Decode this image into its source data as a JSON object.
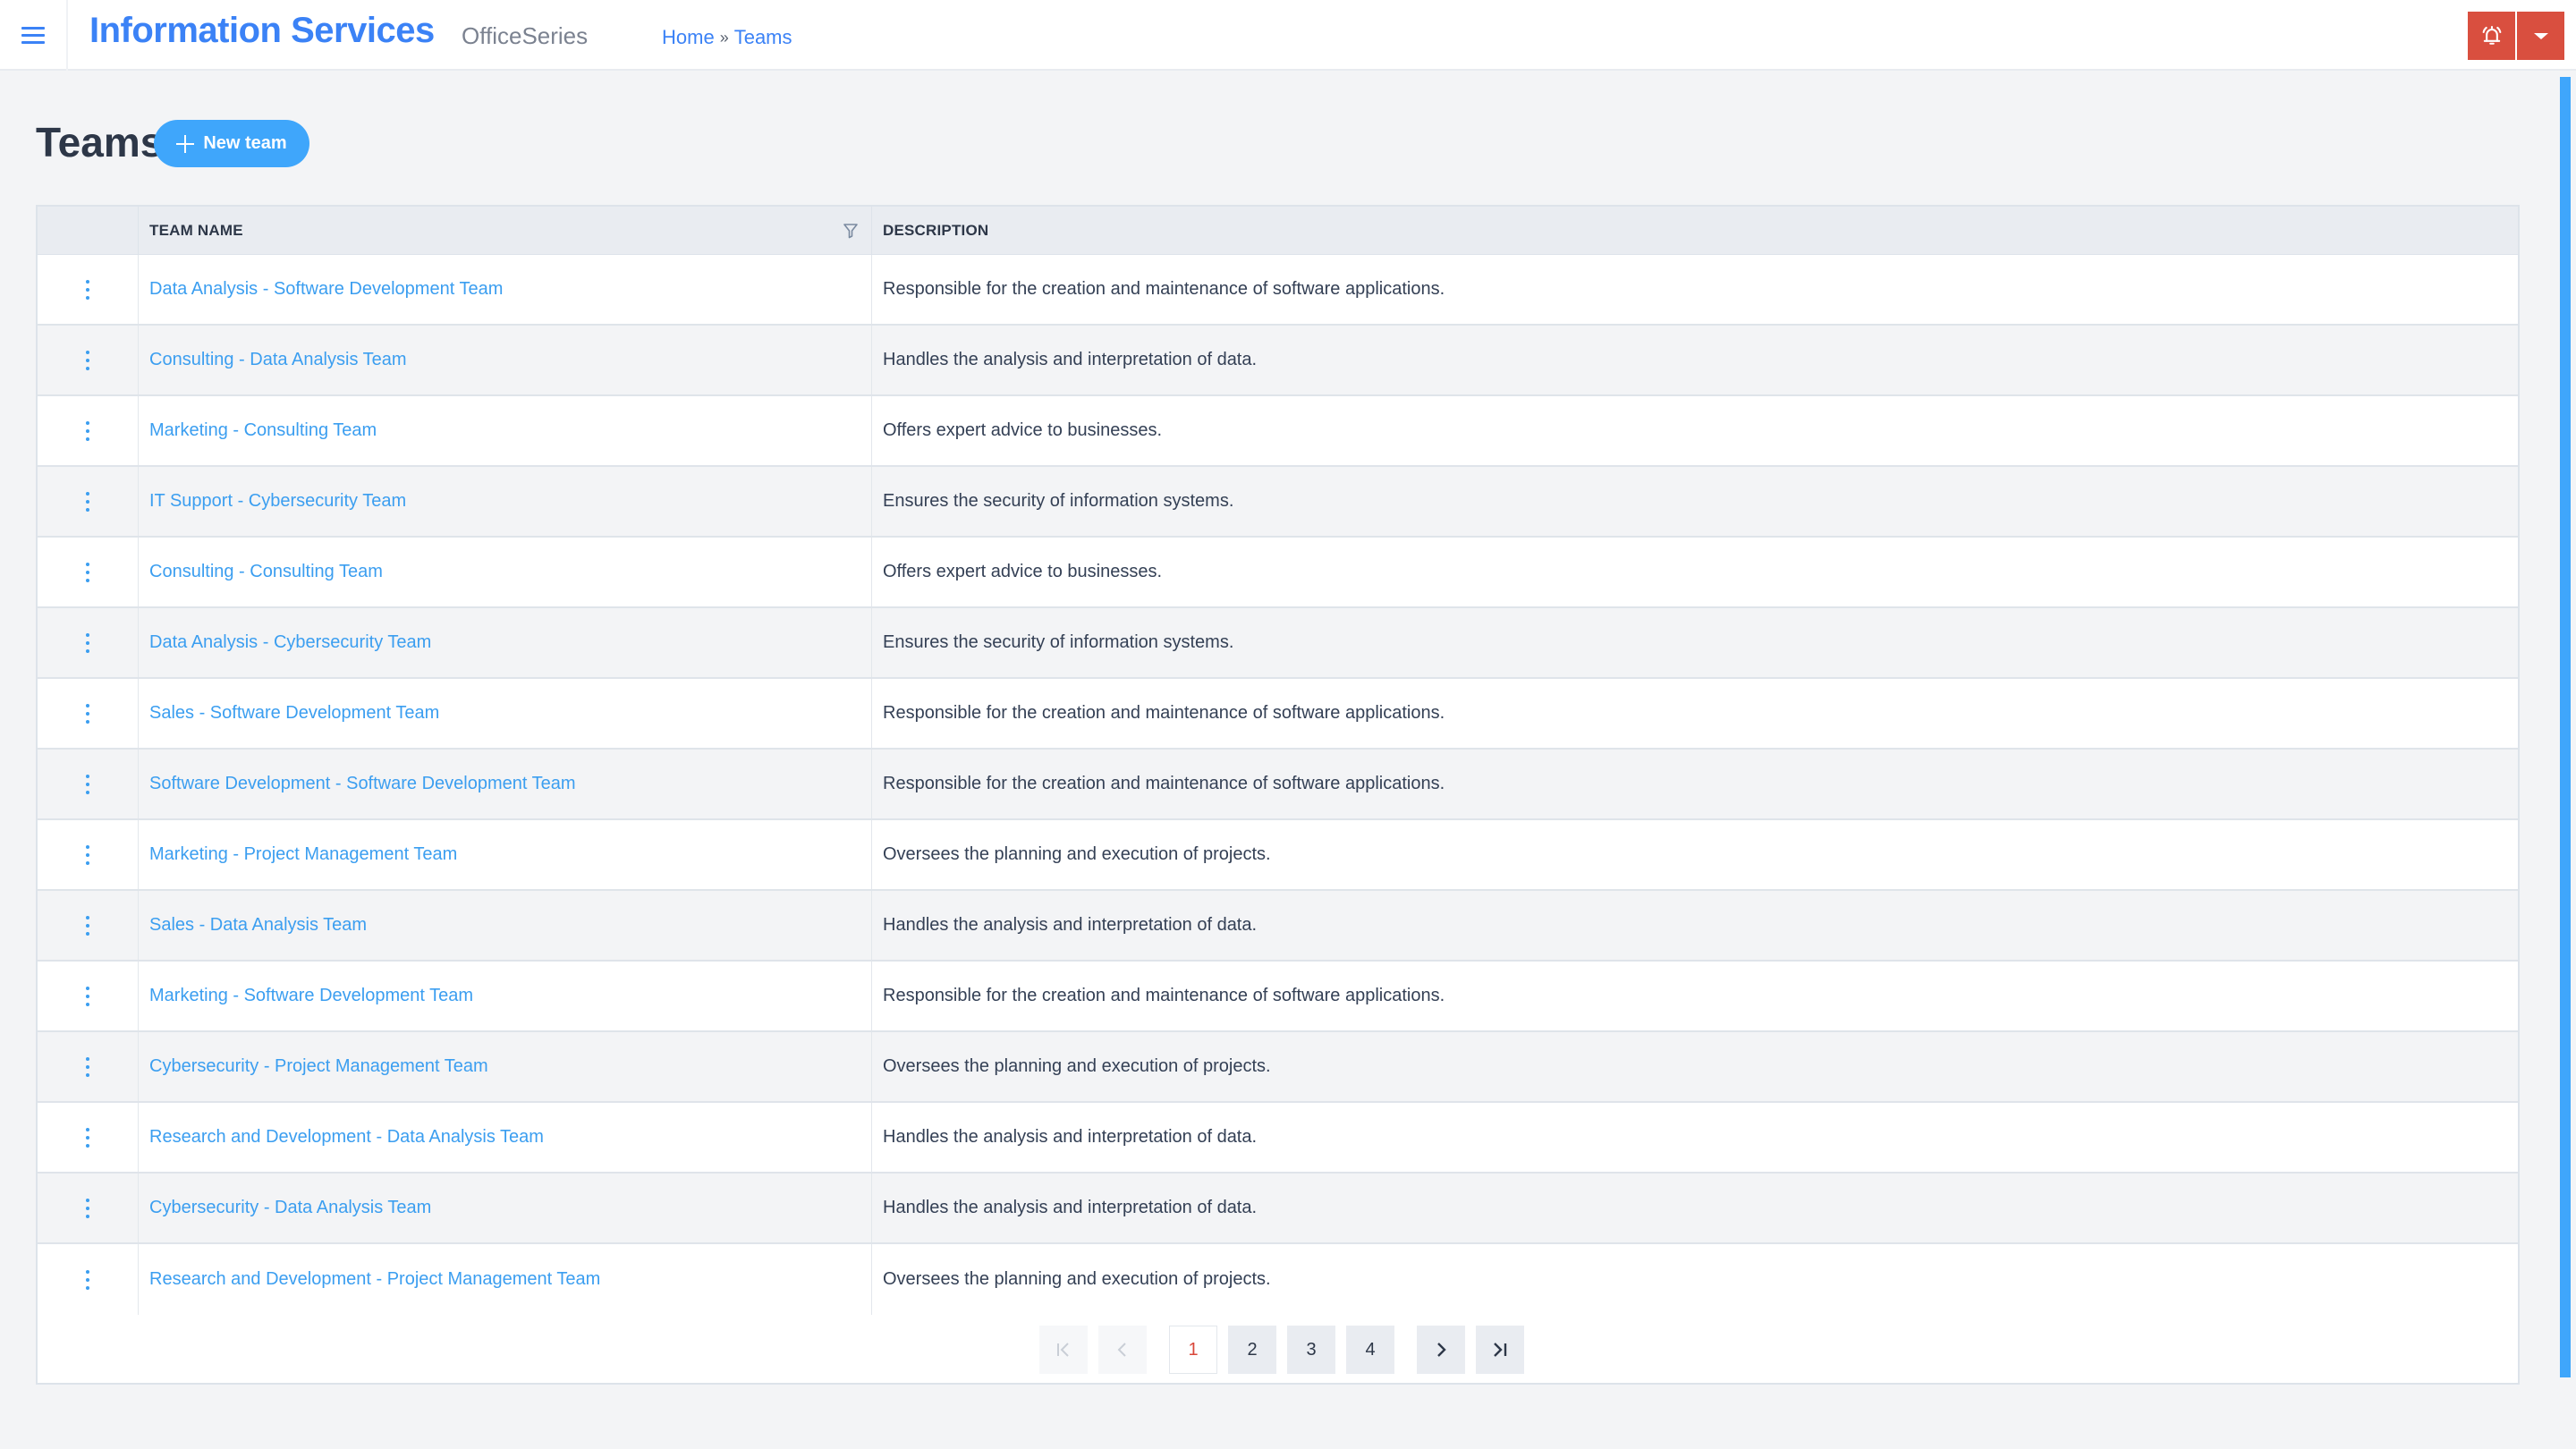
{
  "header": {
    "menu_icon": "hamburger-menu-icon",
    "title": "Information Services",
    "subtitle": "OfficeSeries",
    "breadcrumb": [
      {
        "label": "Home"
      },
      {
        "label": "Teams"
      }
    ],
    "breadcrumb_separator": "»",
    "notification_icon": "bell-ringing-icon",
    "dropdown_icon": "caret-down-icon",
    "accent_color": "#3b82f6",
    "alert_color": "#d94f3f"
  },
  "page": {
    "title": "Teams",
    "new_button_label": "New team",
    "new_button_icon": "plus-icon"
  },
  "table": {
    "columns": [
      {
        "key": "actions",
        "label": ""
      },
      {
        "key": "team_name",
        "label": "Team Name",
        "filter_icon": "filter-icon"
      },
      {
        "key": "description",
        "label": "Description"
      }
    ],
    "row_action_icon": "vertical-dots-icon",
    "rows": [
      {
        "team_name": "Data Analysis - Software Development Team",
        "description": "Responsible for the creation and maintenance of software applications."
      },
      {
        "team_name": "Consulting - Data Analysis Team",
        "description": "Handles the analysis and interpretation of data."
      },
      {
        "team_name": "Marketing - Consulting Team",
        "description": "Offers expert advice to businesses."
      },
      {
        "team_name": "IT Support - Cybersecurity Team",
        "description": "Ensures the security of information systems."
      },
      {
        "team_name": "Consulting - Consulting Team",
        "description": "Offers expert advice to businesses."
      },
      {
        "team_name": "Data Analysis - Cybersecurity Team",
        "description": "Ensures the security of information systems."
      },
      {
        "team_name": "Sales - Software Development Team",
        "description": "Responsible for the creation and maintenance of software applications."
      },
      {
        "team_name": "Software Development - Software Development Team",
        "description": "Responsible for the creation and maintenance of software applications."
      },
      {
        "team_name": "Marketing - Project Management Team",
        "description": "Oversees the planning and execution of projects."
      },
      {
        "team_name": "Sales - Data Analysis Team",
        "description": "Handles the analysis and interpretation of data."
      },
      {
        "team_name": "Marketing - Software Development Team",
        "description": "Responsible for the creation and maintenance of software applications."
      },
      {
        "team_name": "Cybersecurity - Project Management Team",
        "description": "Oversees the planning and execution of projects."
      },
      {
        "team_name": "Research and Development - Data Analysis Team",
        "description": "Handles the analysis and interpretation of data."
      },
      {
        "team_name": "Cybersecurity - Data Analysis Team",
        "description": "Handles the analysis and interpretation of data."
      },
      {
        "team_name": "Research and Development - Project Management Team",
        "description": "Oversees the planning and execution of projects."
      }
    ]
  },
  "pagination": {
    "first_icon": "first-page-icon",
    "prev_icon": "chevron-left-icon",
    "next_icon": "chevron-right-icon",
    "last_icon": "last-page-icon",
    "pages": [
      "1",
      "2",
      "3",
      "4"
    ],
    "current_page": "1",
    "active_color": "#d9473a"
  }
}
